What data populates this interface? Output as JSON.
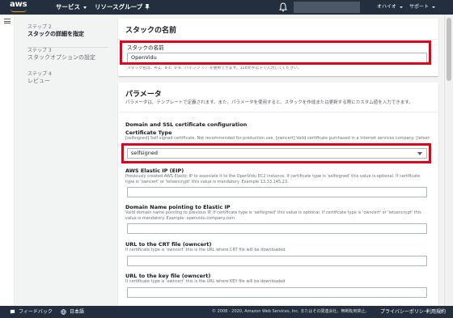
{
  "topnav": {
    "logo_text": "aws",
    "services_label": "サービス",
    "resource_groups_label": "リソースグループ",
    "region_label": "オハイオ",
    "support_label": "サポート"
  },
  "steps": [
    {
      "num": "ステップ 2",
      "title": "スタックの詳細を指定"
    },
    {
      "num": "ステップ 3",
      "title": "スタックオプションの設定"
    },
    {
      "num": "ステップ 4",
      "title": "レビュー"
    }
  ],
  "stack_name_panel": {
    "title": "スタックの名前",
    "field_label": "スタックの名前",
    "field_value": "OpenVidu",
    "hint": "スタック名は、A-Z、a-z、0-9、ハイフン（-）を使用できます。128文字以下で入力してください。"
  },
  "params_panel": {
    "title": "パラメータ",
    "description": "パラメータは、テンプレートで定義されます。また、パラメータを使用すると、スタックを作成または更新する際にカスタム値を入力できます。",
    "section_title": "Domain and SSL certificate configuration",
    "cert_type": {
      "label": "Certificate Type",
      "description": "[selfsigned] Self signed certificate. Not recommended for production use. [owncert] Valid certificate purchased in a Internet services company. [letsencrypt]",
      "value": "selfsigned"
    },
    "elastic_ip": {
      "label": "AWS Elastic IP (EIP)",
      "description": "Previously created AWS Elastic IP to associate it to the OpenVidu EC2 instance. If certificate type is 'selfsigned' this value is optional. If certificate type is 'owncert' or 'letsencrypt' this value is mandatory. Example 13.33.145.23.",
      "value": ""
    },
    "domain_name": {
      "label": "Domain Name pointing to Elastic IP",
      "description": "Valid domain name pointing to previous IP. If certificate type is 'selfsigned' this value is optional. If certificate type is 'owncert' or 'letsencrypt' this value is mandatory. Example: openvidu.company.com",
      "value": ""
    },
    "crt_url": {
      "label": "URL to the CRT file (owncert)",
      "description": "If certificate type is 'owncert' this is the URL where CRT file will be downloaded",
      "value": ""
    },
    "key_url": {
      "label": "URL to the key file (owncert)",
      "description": "If certificate type is 'owncert' this is the URL where KEY file will be downloaded",
      "value": ""
    }
  },
  "footer": {
    "feedback_label": "フィードバック",
    "language_label": "日本語",
    "copyright": "© 2008 - 2020, Amazon Web Services, Inc. またはその関連会社。無断転用禁止。",
    "privacy_label": "プライバシーポリシー",
    "terms_label": "利用規約"
  },
  "colors": {
    "nav_bg": "#232f3e",
    "aws_orange": "#ff9900",
    "highlight_red": "#e3001b"
  }
}
